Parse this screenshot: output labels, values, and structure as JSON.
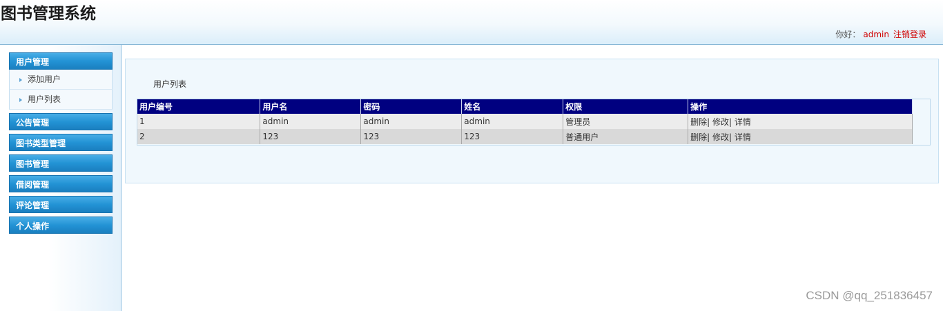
{
  "header": {
    "title": "图书管理系统"
  },
  "userbar": {
    "greeting": "你好：",
    "username": "admin",
    "logout": "注销登录"
  },
  "sidebar": {
    "menus": [
      {
        "label": "用户管理",
        "items": [
          "添加用户",
          "用户列表"
        ]
      },
      {
        "label": "公告管理"
      },
      {
        "label": "图书类型管理"
      },
      {
        "label": "图书管理"
      },
      {
        "label": "借阅管理"
      },
      {
        "label": "评论管理"
      },
      {
        "label": "个人操作"
      }
    ]
  },
  "content": {
    "title": "用户列表",
    "table": {
      "headers": [
        "用户编号",
        "用户名",
        "密码",
        "姓名",
        "权限",
        "操作"
      ],
      "rows": [
        [
          "1",
          "admin",
          "admin",
          "admin",
          "管理员"
        ],
        [
          "2",
          "123",
          "123",
          "123",
          "普通用户"
        ]
      ],
      "actions": [
        "删除|",
        "修改|",
        "详情"
      ]
    }
  },
  "watermark": "CSDN @qq_251836457",
  "colors": {
    "table_header_bg": "#000080",
    "accent_red": "#d00000",
    "menu_blue": "#2393d5"
  }
}
